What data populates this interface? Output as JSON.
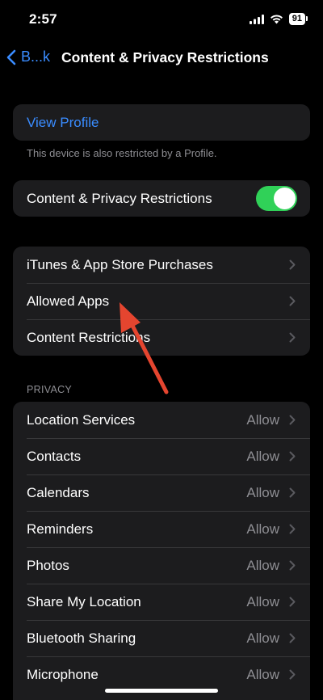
{
  "status_bar": {
    "time": "2:57",
    "battery": "91"
  },
  "nav": {
    "back_label": "B...k",
    "title": "Content & Privacy Restrictions"
  },
  "profile": {
    "view_profile": "View Profile",
    "footnote": "This device is also restricted by a Profile."
  },
  "restrictions_toggle": {
    "label": "Content & Privacy Restrictions",
    "on": true
  },
  "store_group": [
    {
      "label": "iTunes & App Store Purchases"
    },
    {
      "label": "Allowed Apps"
    },
    {
      "label": "Content Restrictions"
    }
  ],
  "privacy": {
    "header": "PRIVACY",
    "items": [
      {
        "label": "Location Services",
        "value": "Allow"
      },
      {
        "label": "Contacts",
        "value": "Allow"
      },
      {
        "label": "Calendars",
        "value": "Allow"
      },
      {
        "label": "Reminders",
        "value": "Allow"
      },
      {
        "label": "Photos",
        "value": "Allow"
      },
      {
        "label": "Share My Location",
        "value": "Allow"
      },
      {
        "label": "Bluetooth Sharing",
        "value": "Allow"
      },
      {
        "label": "Microphone",
        "value": "Allow"
      }
    ]
  },
  "colors": {
    "accent": "#3a8cff",
    "toggle_on": "#30d158",
    "arrow": "#e5452f",
    "group_bg": "#1c1c1e",
    "secondary_text": "#8e8e93"
  },
  "icons": {
    "back": "chevron-left-icon",
    "row_chevron": "chevron-right-icon",
    "signal": "cellular-signal-icon",
    "wifi": "wifi-icon",
    "battery": "battery-icon",
    "annotation": "red-arrow-icon"
  }
}
